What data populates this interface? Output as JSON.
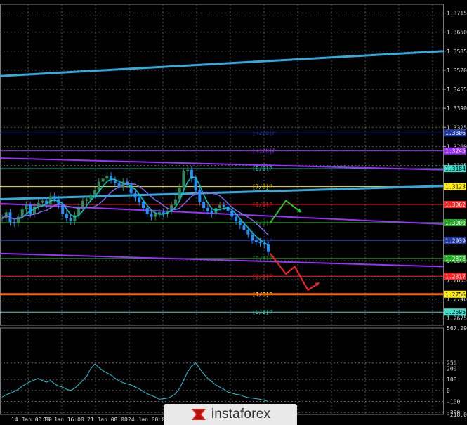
{
  "chart_data": {
    "type": "line",
    "symbol_context": "GBP/USD",
    "main_panel": {
      "price_axis_ticks": [
        "1.3715",
        "1.3650",
        "1.3585",
        "1.3520",
        "1.3455",
        "1.3390",
        "1.3325",
        "1.3260",
        "1.3195",
        "1.2870",
        "1.2805",
        "1.2740",
        "1.2675"
      ],
      "ylim": [
        1.265,
        1.3745
      ],
      "time_axis_labels": [
        "14 Jan 00:00",
        "16 Jan 16:00",
        "21 Jan 08:00",
        "24 Jan 00:00",
        "28 Jan"
      ],
      "close_series": [
        1.3015,
        1.3035,
        1.3002,
        1.2998,
        1.302,
        1.3045,
        1.306,
        1.303,
        1.3055,
        1.3068,
        1.3075,
        1.3062,
        1.309,
        1.308,
        1.306,
        1.303,
        1.3015,
        1.3005,
        1.3025,
        1.3055,
        1.3075,
        1.308,
        1.3095,
        1.311,
        1.314,
        1.315,
        1.316,
        1.3145,
        1.3135,
        1.312,
        1.314,
        1.313,
        1.31,
        1.3085,
        1.307,
        1.305,
        1.303,
        1.302,
        1.303,
        1.3035,
        1.303,
        1.304,
        1.306,
        1.308,
        1.312,
        1.3175,
        1.318,
        1.315,
        1.311,
        1.307,
        1.305,
        1.304,
        1.303,
        1.305,
        1.306,
        1.3055,
        1.304,
        1.302,
        1.3005,
        1.299,
        1.2975,
        1.296,
        1.294,
        1.2935,
        1.293,
        1.2925,
        1.29
      ],
      "series": [
        {
          "name": "Heiken Ashi",
          "color": "#2e8b57"
        },
        {
          "name": "MA fast",
          "color": "#00c8c8"
        },
        {
          "name": "MA slow",
          "color": "#7b68ee"
        }
      ],
      "murray_levels": [
        {
          "label": "[+2/8]P",
          "value": "1.3306",
          "price": 1.3306,
          "color": "#1e3aa8"
        },
        {
          "label": "[+1/8]P",
          "value": "1.3245",
          "price": 1.3245,
          "color": "#9b30ff"
        },
        {
          "label": "[8/8]P",
          "value": "1.3184",
          "price": 1.3184,
          "color": "#40e0d0"
        },
        {
          "label": "[7/8]P",
          "value": "1.3123",
          "price": 1.3123,
          "color": "#ffee00"
        },
        {
          "label": "[6/8]P",
          "value": "1.3062",
          "price": 1.3062,
          "color": "#ff2020"
        },
        {
          "label": "[5/8]P",
          "value": "1.3000",
          "price": 1.3,
          "color": "#22aa22"
        },
        {
          "label": "[4/8]P",
          "value": "1.2939",
          "price": 1.2939,
          "color": "#1e3aa8"
        },
        {
          "label": "[3/8]P",
          "value": "1.2878",
          "price": 1.2878,
          "color": "#22aa22"
        },
        {
          "label": "[2/8]P",
          "value": "1.2817",
          "price": 1.2817,
          "color": "#ff2020"
        },
        {
          "label": "[1/8]P",
          "value": "1.2756",
          "price": 1.2756,
          "color": "#ffee00"
        },
        {
          "label": "[0/8]P",
          "value": "1.2695",
          "price": 1.2695,
          "color": "#40e0d0"
        }
      ],
      "trend_lines": [
        {
          "name": "upper channel",
          "color": "#33aadd",
          "from": [
            0,
            1.35
          ],
          "to": [
            1,
            1.3585
          ]
        },
        {
          "name": "lower channel",
          "color": "#33aadd",
          "from": [
            0,
            1.308
          ],
          "to": [
            1,
            1.3125
          ]
        },
        {
          "name": "upper regression",
          "color": "#9b30ff",
          "from": [
            0,
            1.322
          ],
          "to": [
            1,
            1.318
          ]
        },
        {
          "name": "middle regression",
          "color": "#9b30ff",
          "from": [
            0,
            1.3065
          ],
          "to": [
            1,
            1.2995
          ]
        },
        {
          "name": "lower regression",
          "color": "#9b30ff",
          "from": [
            0,
            1.2895
          ],
          "to": [
            1,
            1.285
          ]
        }
      ],
      "horizontal_lines": [
        {
          "color": "#ff6000",
          "price": 1.2756
        }
      ],
      "forecast_arrows": [
        {
          "color": "#22cc22",
          "points": [
            [
              0.61,
              1.3
            ],
            [
              0.645,
              1.3075
            ],
            [
              0.68,
              1.3035
            ]
          ]
        },
        {
          "color": "#ff2020",
          "points": [
            [
              0.61,
              1.2895
            ],
            [
              0.645,
              1.2825
            ],
            [
              0.665,
              1.285
            ],
            [
              0.695,
              1.277
            ],
            [
              0.72,
              1.2795
            ]
          ]
        }
      ]
    },
    "indicator_panel": {
      "name": "CCI",
      "ticks": [
        "567.2935",
        "250",
        "200",
        "100",
        "0",
        "-100",
        "-200",
        "-218.0649"
      ],
      "ylim": [
        -218.0649,
        567.2935
      ],
      "levels": [
        250,
        100,
        0,
        -100,
        -200
      ],
      "values": [
        -60,
        -40,
        -25,
        -10,
        10,
        40,
        60,
        80,
        95,
        110,
        90,
        75,
        90,
        60,
        40,
        30,
        10,
        0,
        20,
        55,
        90,
        130,
        200,
        240,
        210,
        180,
        160,
        140,
        110,
        90,
        70,
        60,
        50,
        30,
        15,
        -10,
        -30,
        -45,
        -60,
        -80,
        -75,
        -70,
        -55,
        -30,
        20,
        90,
        170,
        220,
        250,
        200,
        150,
        110,
        80,
        50,
        30,
        10,
        -15,
        -25,
        -35,
        -40,
        -55,
        -65,
        -70,
        -75,
        -80,
        -90,
        -100
      ]
    }
  },
  "logo": {
    "text": "instaforex"
  }
}
